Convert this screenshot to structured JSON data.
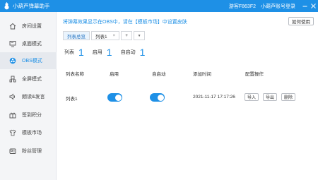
{
  "app": {
    "title": "小葫芦弹幕助手",
    "guest_label": "游客F863F2",
    "login_label": "小葫芦账号登录",
    "colors": {
      "primary": "#1e90e6",
      "sidebar_bg": "#f4f5f7"
    }
  },
  "sidebar": {
    "items": [
      {
        "label": "房间设置",
        "icon": "house-icon"
      },
      {
        "label": "桌面模式",
        "icon": "monitor-icon"
      },
      {
        "label": "OBS模式",
        "icon": "obs-icon",
        "active": true
      },
      {
        "label": "全屏模式",
        "icon": "fullscreen-icon"
      },
      {
        "label": "朗读&发言",
        "icon": "speaker-icon"
      },
      {
        "label": "签到积分",
        "icon": "gift-icon"
      },
      {
        "label": "模板市场",
        "icon": "shirt-icon"
      },
      {
        "label": "粉丝管理",
        "icon": "fans-icon"
      }
    ]
  },
  "main": {
    "notice": "将弹幕效果显示在OBS中，请在【模板市场】中设置皮肤",
    "help_button": "如何使用",
    "tabs": [
      {
        "label": "列表总览",
        "selected": true
      },
      {
        "label": "列表1",
        "close": "×"
      },
      {
        "label": "+"
      },
      {
        "label": "▼"
      }
    ],
    "stats": [
      {
        "label": "列表",
        "value": "1"
      },
      {
        "label": "启用",
        "value": "1"
      },
      {
        "label": "自启动",
        "value": "1"
      }
    ],
    "table": {
      "headers": [
        "列表名称",
        "启用",
        "自启动",
        "添加时间",
        "配置操作"
      ],
      "rows": [
        {
          "name": "列表1",
          "enabled": true,
          "autostart": true,
          "time": "2021-11-17 17:17:26",
          "actions": [
            "导入",
            "导出",
            "删除"
          ]
        }
      ]
    }
  }
}
